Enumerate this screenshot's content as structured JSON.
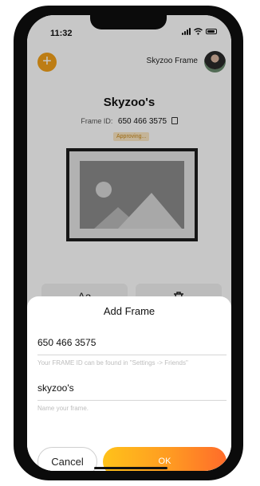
{
  "status_bar": {
    "time": "11:32"
  },
  "header": {
    "frame_name": "Skyzoo Frame"
  },
  "frame": {
    "title": "Skyzoo's",
    "id_label": "Frame ID:",
    "id_value": "650 466 3575",
    "status_badge": "Approving..."
  },
  "actions": [
    {
      "label": "Aa",
      "icon": "text-icon"
    },
    {
      "label": "",
      "icon": "trash-icon"
    }
  ],
  "sheet": {
    "title": "Add Frame",
    "frame_id_value": "650 466 3575",
    "frame_id_hint": "Your FRAME ID can be found in \"Settings -> Friends\"",
    "name_value": "skyzoo's",
    "name_hint": "Name your frame.",
    "cancel_label": "Cancel",
    "ok_label": "OK"
  },
  "colors": {
    "accent": "#f2a11a",
    "ok_gradient_start": "#ffc21a",
    "ok_gradient_end": "#ff6b2a",
    "badge_bg": "#fbe7c3",
    "badge_text": "#c9891a"
  }
}
